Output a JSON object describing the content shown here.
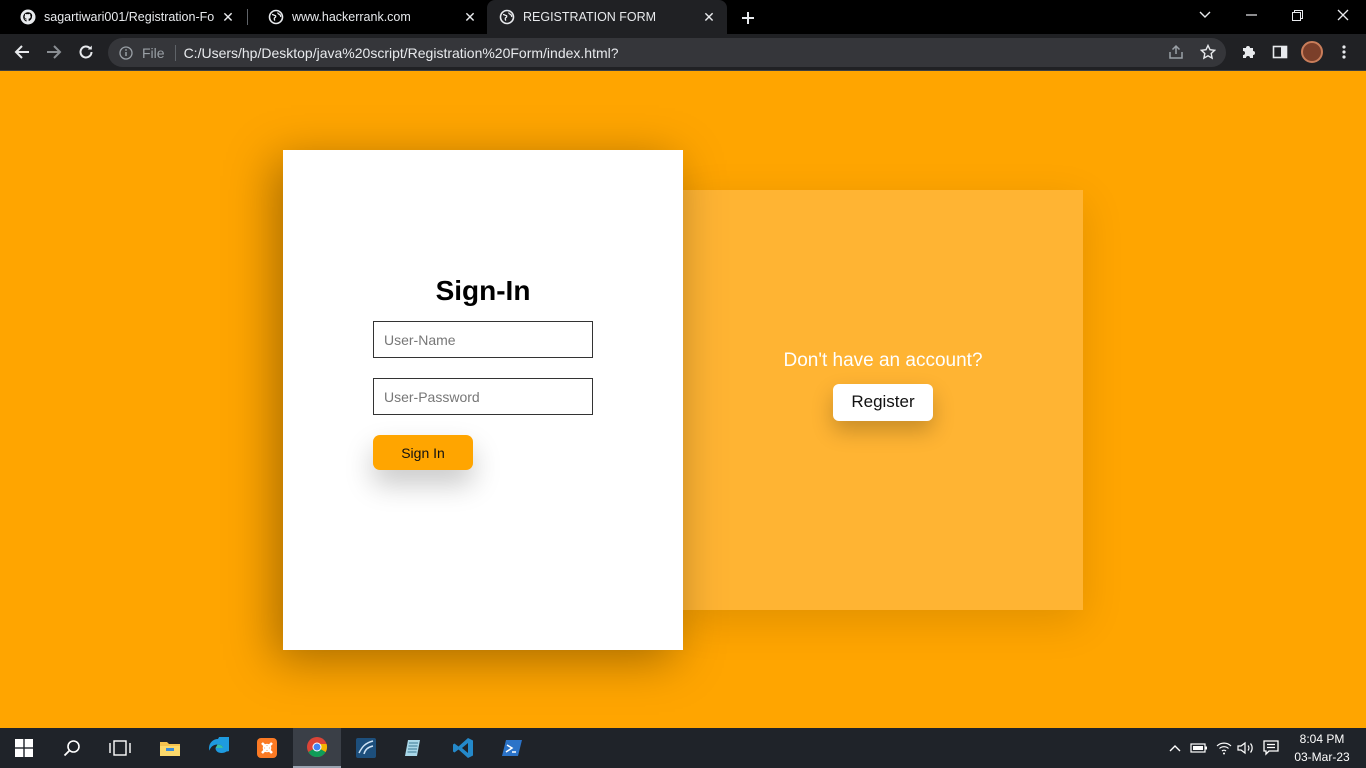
{
  "browser": {
    "tabs": [
      {
        "title": "sagartiwari001/Registration-Form",
        "favicon": "github-icon",
        "active": false
      },
      {
        "title": "www.hackerrank.com",
        "favicon": "globe-icon",
        "active": false
      },
      {
        "title": "REGISTRATION FORM",
        "favicon": "globe-icon",
        "active": true
      }
    ],
    "address": {
      "scheme_label": "File",
      "url": "C:/Users/hp/Desktop/java%20script/Registration%20Form/index.html?"
    }
  },
  "page": {
    "signin": {
      "title": "Sign-In",
      "username_placeholder": "User-Name",
      "password_placeholder": "User-Password",
      "button_label": "Sign In"
    },
    "register_panel": {
      "prompt": "Don't have an account?",
      "button_label": "Register"
    }
  },
  "taskbar": {
    "apps": [
      "start-icon",
      "search-icon",
      "task-view-icon",
      "file-explorer-icon",
      "edge-icon",
      "xampp-icon",
      "chrome-icon",
      "mysql-workbench-icon",
      "notepad-icon",
      "vscode-icon",
      "powershell-icon"
    ],
    "active_app": "chrome-icon",
    "time": "8:04 PM",
    "date": "03-Mar-23"
  },
  "colors": {
    "page_background": "#ffa500",
    "register_panel": "#ffb433",
    "signin_button": "#ffa500",
    "browser_chrome": "#202124"
  }
}
